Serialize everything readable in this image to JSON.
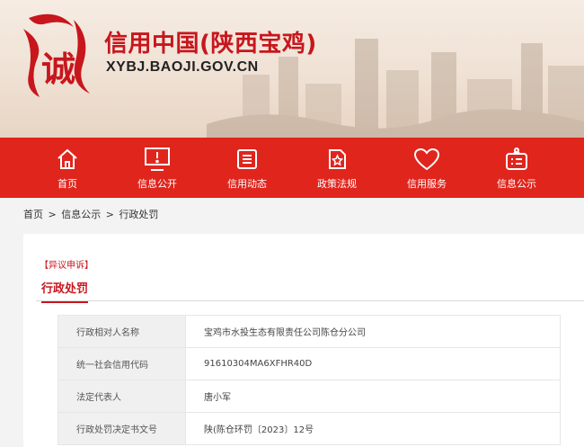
{
  "header": {
    "title": "信用中国(陕西宝鸡)",
    "url": "XYBJ.BAOJI.GOV.CN",
    "logo_char": "诚"
  },
  "nav": {
    "items": [
      {
        "label": "首页",
        "icon": "home-icon"
      },
      {
        "label": "信息公开",
        "icon": "monitor-alert-icon"
      },
      {
        "label": "信用动态",
        "icon": "document-list-icon"
      },
      {
        "label": "政策法规",
        "icon": "star-document-icon"
      },
      {
        "label": "信用服务",
        "icon": "heart-icon"
      },
      {
        "label": "信息公示",
        "icon": "announcement-icon"
      }
    ]
  },
  "breadcrumb": {
    "items": [
      "首页",
      "信息公示",
      "行政处罚"
    ],
    "sep": ">"
  },
  "content": {
    "objection_link": "【异议申诉】",
    "section_title": "行政处罚",
    "rows": [
      {
        "key": "行政相对人名称",
        "value": "宝鸡市水投生态有限责任公司陈仓分公司"
      },
      {
        "key": "统一社会信用代码",
        "value": "91610304MA6XFHR40D"
      },
      {
        "key": "法定代表人",
        "value": "唐小军"
      },
      {
        "key": "行政处罚决定书文号",
        "value": "陕(陈仓环罚〔2023〕12号"
      }
    ]
  },
  "colors": {
    "brand_red": "#e0251d",
    "title_red": "#c8161d"
  }
}
